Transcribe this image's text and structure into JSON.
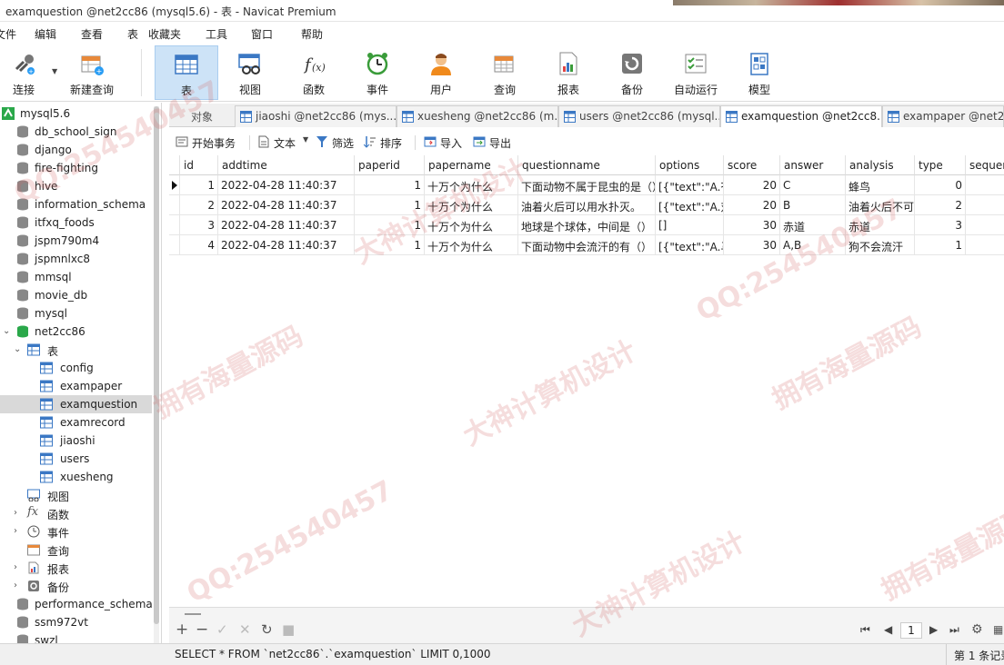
{
  "window": {
    "title": "examquestion @net2cc86 (mysql5.6) - 表 - Navicat Premium"
  },
  "menu": [
    "文件",
    "编辑",
    "查看",
    "表",
    "收藏夹",
    "工具",
    "窗口",
    "帮助"
  ],
  "toolbar": {
    "buttons": [
      {
        "label": "连接",
        "icon": "connect-icon"
      },
      {
        "label": "新建查询",
        "icon": "new-query-icon"
      },
      {
        "label": "表",
        "icon": "table-icon",
        "active": true
      },
      {
        "label": "视图",
        "icon": "view-icon"
      },
      {
        "label": "函数",
        "icon": "function-icon"
      },
      {
        "label": "事件",
        "icon": "event-clock-icon"
      },
      {
        "label": "用户",
        "icon": "user-icon"
      },
      {
        "label": "查询",
        "icon": "query-icon"
      },
      {
        "label": "报表",
        "icon": "report-icon"
      },
      {
        "label": "备份",
        "icon": "backup-icon"
      },
      {
        "label": "自动运行",
        "icon": "automation-icon"
      },
      {
        "label": "模型",
        "icon": "model-icon"
      }
    ]
  },
  "nav": {
    "connection": "mysql5.6",
    "databases_before": [
      "db_school_sign",
      "django",
      "fire-fighting",
      "hive",
      "information_schema",
      "itfxq_foods",
      "jspm790m4",
      "jspmnlxc8",
      "mmsql",
      "movie_db",
      "mysql"
    ],
    "open_db": "net2cc86",
    "tables_group": "表",
    "tables": [
      "config",
      "exampaper",
      "examquestion",
      "examrecord",
      "jiaoshi",
      "users",
      "xuesheng"
    ],
    "selected_table": "examquestion",
    "other_groups": [
      "视图",
      "函数",
      "事件",
      "查询",
      "报表",
      "备份"
    ],
    "databases_after": [
      "performance_schema",
      "ssm972vt",
      "swzl"
    ]
  },
  "tabs": {
    "objects_label": "对象",
    "items": [
      {
        "label": "jiaoshi @net2cc86 (mys..."
      },
      {
        "label": "xuesheng @net2cc86 (m..."
      },
      {
        "label": "users @net2cc86 (mysql..."
      },
      {
        "label": "examquestion @net2cc8...",
        "active": true
      },
      {
        "label": "exampaper @net2c"
      }
    ]
  },
  "grid_toolbar": {
    "begin_transaction": "开始事务",
    "text": "文本",
    "filter": "筛选",
    "sort": "排序",
    "import": "导入",
    "export": "导出"
  },
  "table": {
    "columns": [
      "id",
      "addtime",
      "paperid",
      "papername",
      "questionname",
      "options",
      "score",
      "answer",
      "analysis",
      "type",
      "sequen"
    ],
    "rows": [
      [
        "1",
        "2022-04-28 11:40:37",
        "1",
        "十万个为什么",
        "下面动物不属于昆虫的是（）",
        "[{\"text\":\"A.苍",
        "20",
        "C",
        "蜂鸟",
        "0",
        ""
      ],
      [
        "2",
        "2022-04-28 11:40:37",
        "1",
        "十万个为什么",
        "油着火后可以用水扑灭。",
        "[{\"text\":\"A.对",
        "20",
        "B",
        "油着火后不可",
        "2",
        ""
      ],
      [
        "3",
        "2022-04-28 11:40:37",
        "1",
        "十万个为什么",
        "地球是个球体，中间是（）",
        "[]",
        "30",
        "赤道",
        "赤道",
        "3",
        ""
      ],
      [
        "4",
        "2022-04-28 11:40:37",
        "1",
        "十万个为什么",
        "下面动物中会流汗的有（）",
        "[{\"text\":\"A.马",
        "30",
        "A,B",
        "狗不会流汗",
        "1",
        ""
      ]
    ]
  },
  "pager": {
    "page": "1"
  },
  "status": {
    "sql": "SELECT * FROM `net2cc86`.`examquestion` LIMIT 0,1000",
    "record": "第 1 条记录"
  },
  "watermark": [
    "QQ:254540457",
    "大神计算机设计",
    "拥有海量源码"
  ],
  "colors": {
    "active_tool": "#cde3f7",
    "selected_row": "#d9d9d9",
    "db_green": "#2aa84a",
    "table_blue": "#3b78c4"
  }
}
